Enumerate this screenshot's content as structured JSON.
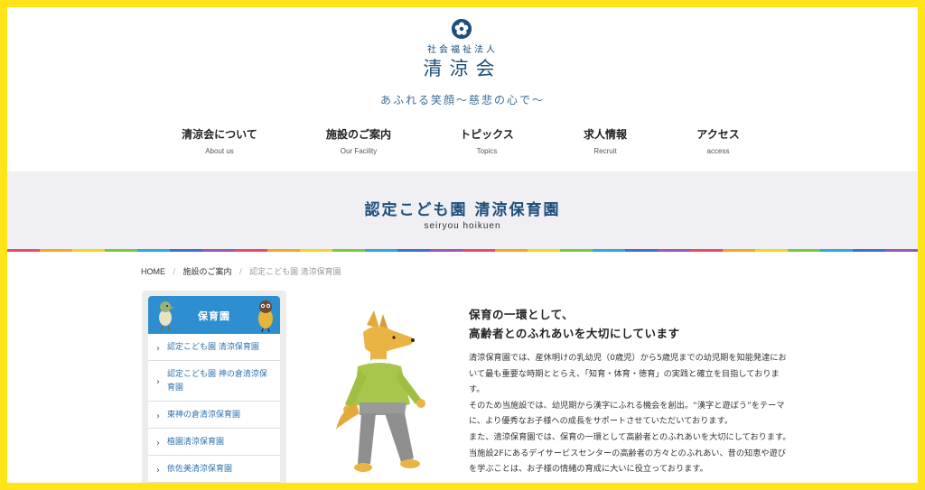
{
  "header": {
    "org_type": "社会福祉法人",
    "org_name": "清涼会",
    "tagline": "あふれる笑顔〜慈悲の心で〜"
  },
  "nav": {
    "items": [
      {
        "label": "清涼会について",
        "sub": "About us"
      },
      {
        "label": "施設のご案内",
        "sub": "Our Facility"
      },
      {
        "label": "トピックス",
        "sub": "Topics"
      },
      {
        "label": "求人情報",
        "sub": "Recruit"
      },
      {
        "label": "アクセス",
        "sub": "access"
      }
    ]
  },
  "banner": {
    "title": "認定こども園 清涼保育園",
    "subtitle": "seiryou hoikuen"
  },
  "breadcrumb": {
    "home": "HOME",
    "separator": "/",
    "parent": "施設のご案内",
    "current": "認定こども園 清涼保育園"
  },
  "sidebar": {
    "title": "保育園",
    "items": [
      {
        "label": "認定こども園 清涼保育園"
      },
      {
        "label": "認定こども園 神の倉清涼保育園"
      },
      {
        "label": "東神の倉清涼保育園"
      },
      {
        "label": "植園清涼保育園"
      },
      {
        "label": "依佐美清涼保育園"
      }
    ]
  },
  "main": {
    "heading_line1": "保育の一環として、",
    "heading_line2": "高齢者とのふれあいを大切にしています",
    "paragraph1": "清涼保育園では、産休明けの乳幼児（0歳児）から5歳児までの幼児期を知能発達において最も重要な時期ととらえ、「知育・体育・徳育」の実践と確立を目指しております。",
    "paragraph2": "そのため当施設では、幼児期から漢字にふれる機会を創出。“漢字と遊ぼう”をテーマに、より優秀なお子様への成長をサポートさせていただいております。",
    "paragraph3": "また、清涼保育園では、保育の一環として高齢者とのふれあいを大切にしております。当施設2Fにあるデイサービスセンターの高齢者の方々とのふれあい、昔の知恵や遊びを学ぶことは、お子様の情緒の育成に大いに役立っております。"
  },
  "colors": {
    "frame": "#ffe419",
    "brand_navy": "#1d4f7a",
    "sidebar_header": "#2d8fd0",
    "link": "#2e73b0",
    "banner_bg": "#efeff4",
    "stripe": [
      "#e94b6a",
      "#f5a623",
      "#f7d51d",
      "#7ac943",
      "#29abe2",
      "#3f6fd8",
      "#9b59b6"
    ]
  },
  "icons": [
    "flower-logo-icon",
    "chevron-right-icon",
    "bird-character-icon",
    "owl-character-icon",
    "dog-character-icon"
  ]
}
